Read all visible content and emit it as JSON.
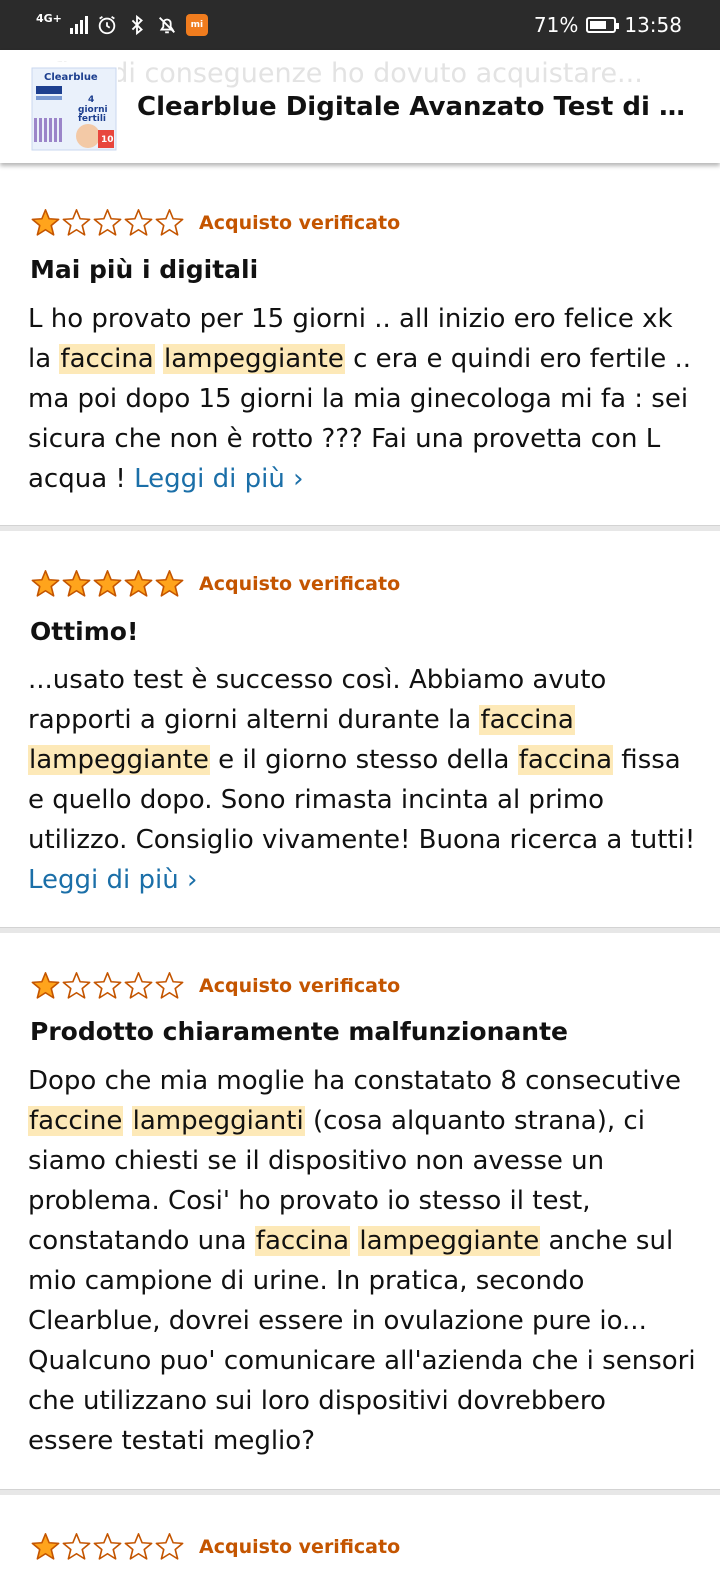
{
  "status_bar": {
    "network": "4G+",
    "battery_text": "71%",
    "battery_level": 0.71,
    "time": "13:58"
  },
  "product": {
    "title": "Clearblue Digitale Avanzato Test di O...",
    "ghost_text": "fino di conseguenze ho dovuto acquistare...",
    "thumb_brand": "Clearblue",
    "thumb_line1": "4",
    "thumb_line2": "giorni",
    "thumb_line3": "fertili",
    "thumb_count": "10"
  },
  "reviews": [
    {
      "rating": 1,
      "verified": "Acquisto verificato",
      "title": "Mai più i digitali",
      "body": [
        {
          "t": "L ho provato per 15 giorni .. all inizio ero felice xk la "
        },
        {
          "t": "faccina",
          "hl": true
        },
        {
          "t": " "
        },
        {
          "t": "lampeggiante",
          "hl": true
        },
        {
          "t": " c era e quindi ero fertile .. ma poi dopo 15 giorni la mia ginecologa mi fa : sei sicura che non è rotto ??? Fai una provetta con L acqua ! "
        }
      ],
      "read_more": "Leggi di più ›"
    },
    {
      "rating": 5,
      "verified": "Acquisto verificato",
      "title": "Ottimo!",
      "body": [
        {
          "t": "...usato test è successo così. Abbiamo avuto rapporti a giorni alterni durante la "
        },
        {
          "t": "faccina",
          "hl": true
        },
        {
          "t": " "
        },
        {
          "t": "lampeggiante",
          "hl": true
        },
        {
          "t": " e il giorno stesso della "
        },
        {
          "t": "faccina",
          "hl": true
        },
        {
          "t": " fissa e quello dopo. Sono rimasta incinta al primo utilizzo. Consiglio vivamente! Buona ricerca a tutti! "
        }
      ],
      "read_more": "Leggi di più ›"
    },
    {
      "rating": 1,
      "verified": "Acquisto verificato",
      "title": "Prodotto chiaramente malfunzionante",
      "body": [
        {
          "t": "Dopo che mia moglie ha constatato 8 consecutive "
        },
        {
          "t": "faccine",
          "hl": true
        },
        {
          "t": " "
        },
        {
          "t": "lampeggianti",
          "hl": true
        },
        {
          "t": " (cosa alquanto strana), ci siamo chiesti se il dispositivo non avesse un problema. Cosi' ho provato io stesso il test, constatando una "
        },
        {
          "t": "faccina",
          "hl": true
        },
        {
          "t": " "
        },
        {
          "t": "lampeggiante",
          "hl": true
        },
        {
          "t": " anche sul mio campione di urine. In pratica, secondo Clearblue, dovrei essere in ovulazione pure io... Qualcuno puo' comunicare all'azienda che i sensori che utilizzano sui loro dispositivi dovrebbero essere testati meglio?"
        }
      ],
      "read_more": ""
    },
    {
      "rating": 1,
      "verified": "Acquisto verificato",
      "title": "",
      "body": [],
      "read_more": ""
    }
  ],
  "colors": {
    "star_fill": "#ffa41c",
    "star_stroke": "#c45500",
    "verified": "#c45500",
    "highlight": "#fde9b8",
    "link": "#1b6fa8"
  }
}
